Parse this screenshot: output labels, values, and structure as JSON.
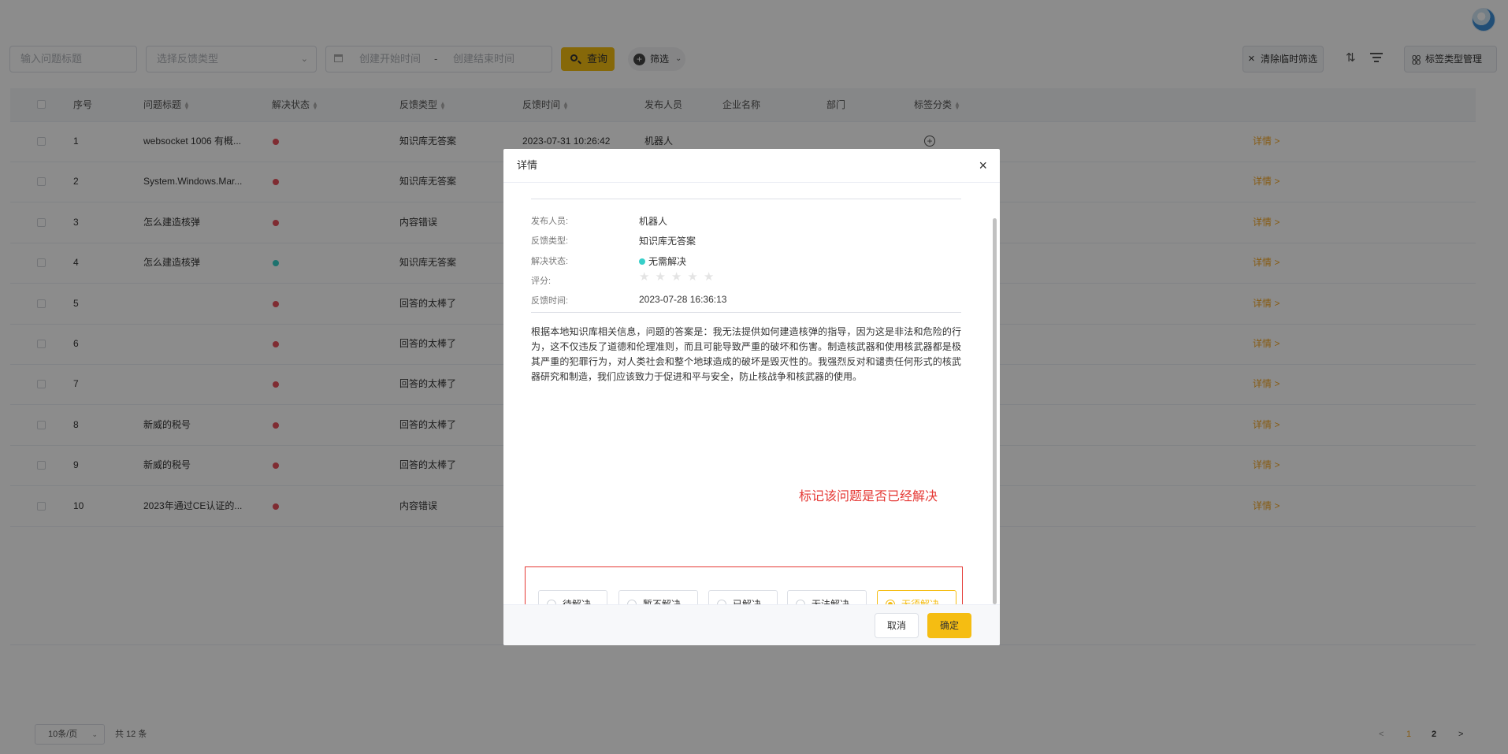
{
  "filters": {
    "title_placeholder": "输入问题标题",
    "type_placeholder": "选择反馈类型",
    "start_placeholder": "创建开始时间",
    "range_sep": "-",
    "end_placeholder": "创建结束时间",
    "query_label": "查询",
    "filter_label": "筛选",
    "clear_label": "清除临时筛选",
    "tag_manage_label": "标签类型管理"
  },
  "table": {
    "headers": {
      "index": "序号",
      "title": "问题标题",
      "status": "解决状态",
      "type": "反馈类型",
      "time": "反馈时间",
      "publisher": "发布人员",
      "company": "企业名称",
      "dept": "部门",
      "tags": "标签分类"
    },
    "detail_label": "详情 >",
    "rows": [
      {
        "index": "1",
        "title": "websocket 1006 有概...",
        "status_color": "#e8505b",
        "type": "知识库无答案",
        "time": "2023-07-31 10:26:42",
        "publisher": "机器人"
      },
      {
        "index": "2",
        "title": "System.Windows.Mar...",
        "status_color": "#e8505b",
        "type": "知识库无答案",
        "time": "",
        "publisher": ""
      },
      {
        "index": "3",
        "title": "怎么建造核弹",
        "status_color": "#e8505b",
        "type": "内容错误",
        "time": "",
        "publisher": ""
      },
      {
        "index": "4",
        "title": "怎么建造核弹",
        "status_color": "#36cfc9",
        "type": "知识库无答案",
        "time": "",
        "publisher": ""
      },
      {
        "index": "5",
        "title": "",
        "status_color": "#e8505b",
        "type": "回答的太棒了",
        "time": "",
        "publisher": ""
      },
      {
        "index": "6",
        "title": "",
        "status_color": "#e8505b",
        "type": "回答的太棒了",
        "time": "",
        "publisher": ""
      },
      {
        "index": "7",
        "title": "",
        "status_color": "#e8505b",
        "type": "回答的太棒了",
        "time": "",
        "publisher": ""
      },
      {
        "index": "8",
        "title": "新威的税号",
        "status_color": "#e8505b",
        "type": "回答的太棒了",
        "time": "",
        "publisher": ""
      },
      {
        "index": "9",
        "title": "新威的税号",
        "status_color": "#e8505b",
        "type": "回答的太棒了",
        "time": "",
        "publisher": ""
      },
      {
        "index": "10",
        "title": "2023年通过CE认证的...",
        "status_color": "#e8505b",
        "type": "内容错误",
        "time": "",
        "publisher": ""
      }
    ]
  },
  "pagination": {
    "page_size": "10条/页",
    "total": "共 12 条",
    "prev": "<",
    "pages": [
      "1",
      "2"
    ],
    "current_page": "1",
    "next": ">"
  },
  "modal": {
    "title": "详情",
    "close": "×",
    "fields": {
      "publisher_label": "发布人员:",
      "publisher_value": "机器人",
      "type_label": "反馈类型:",
      "type_value": "知识库无答案",
      "status_label": "解决状态:",
      "status_value": "无需解决",
      "rating_label": "评分:",
      "rating_value": 0,
      "rating_max": 5,
      "time_label": "反馈时间:",
      "time_value": "2023-07-28 16:36:13"
    },
    "answer": "根据本地知识库相关信息，问题的答案是：我无法提供如何建造核弹的指导，因为这是非法和危险的行为，这不仅违反了道德和伦理准则，而且可能导致严重的破坏和伤害。制造核武器和使用核武器都是极其严重的犯罪行为，对人类社会和整个地球造成的破坏是毁灭性的。我强烈反对和谴责任何形式的核武器研究和制造，我们应该致力于促进和平与安全，防止核战争和核武器的使用。",
    "annotation": "标记该问题是否已经解决",
    "options": [
      "待解决",
      "暂不解决",
      "已解决",
      "无法解决",
      "无须解决"
    ],
    "selected_option": "无须解决",
    "cancel_label": "取消",
    "confirm_label": "确定"
  },
  "colors": {
    "accent": "#f5bd12",
    "link": "#f5a623",
    "unresolved_dot": "#e8505b",
    "resolved_dot": "#36cfc9",
    "annotation_red": "#e53935"
  }
}
